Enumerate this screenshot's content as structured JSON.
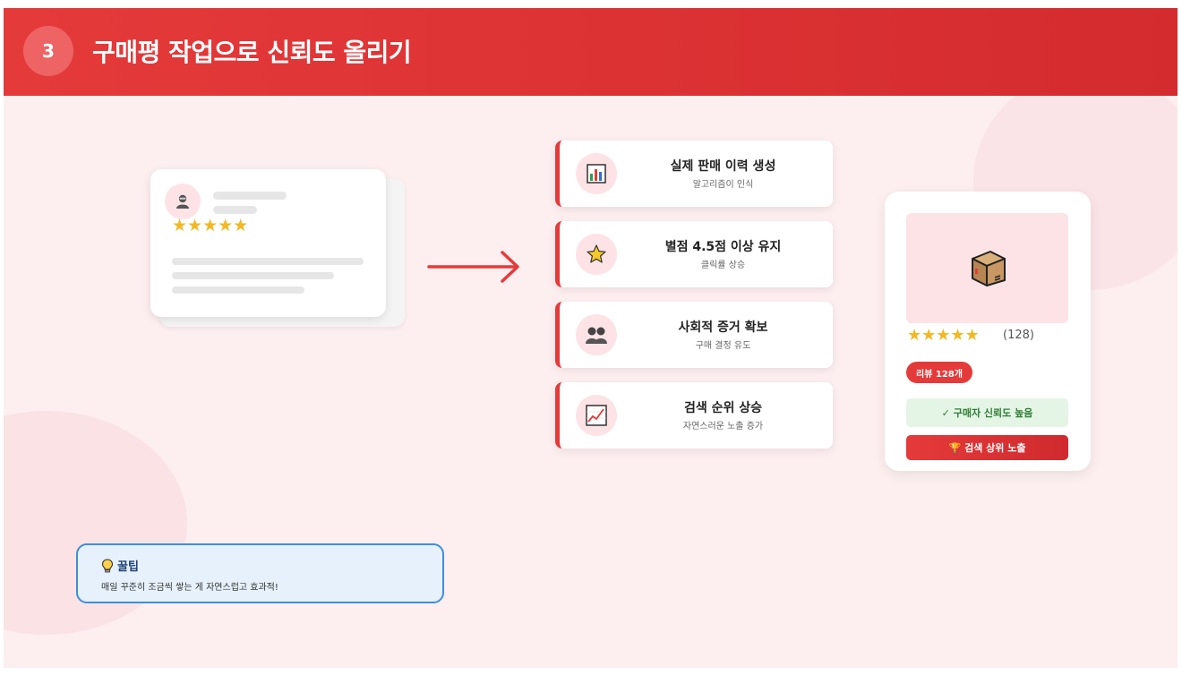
{
  "header": {
    "step_number": "3",
    "title": "구매평 작업으로 신뢰도 올리기"
  },
  "review_card": {
    "stars": "★★★★★"
  },
  "benefits": [
    {
      "icon": "bar-chart-icon",
      "title": "실제 판매 이력 생성",
      "subtitle": "알고리즘이 인식"
    },
    {
      "icon": "star-icon",
      "title": "별점 4.5점 이상 유지",
      "subtitle": "클릭률 상승"
    },
    {
      "icon": "people-icon",
      "title": "사회적 증거 확보",
      "subtitle": "구매 결정 유도"
    },
    {
      "icon": "trend-chart-icon",
      "title": "검색 순위 상승",
      "subtitle": "자연스러운 노출 증가"
    }
  ],
  "product_card": {
    "stars": "★★★★★",
    "review_count": "(128)",
    "review_pill": "리뷰 128개",
    "trust_label": "✓ 구매자 신뢰도 높음",
    "rank_label": "🏆 검색 상위 노출"
  },
  "tip": {
    "title": "꿀팁",
    "text": "매일 꾸준히 조금씩 쌓는 게 자연스럽고 효과적!"
  },
  "colors": {
    "accent": "#e53a3a",
    "star": "#f3b822",
    "trust_green": "#2e7d32",
    "tip_border": "#3d8fd8"
  }
}
